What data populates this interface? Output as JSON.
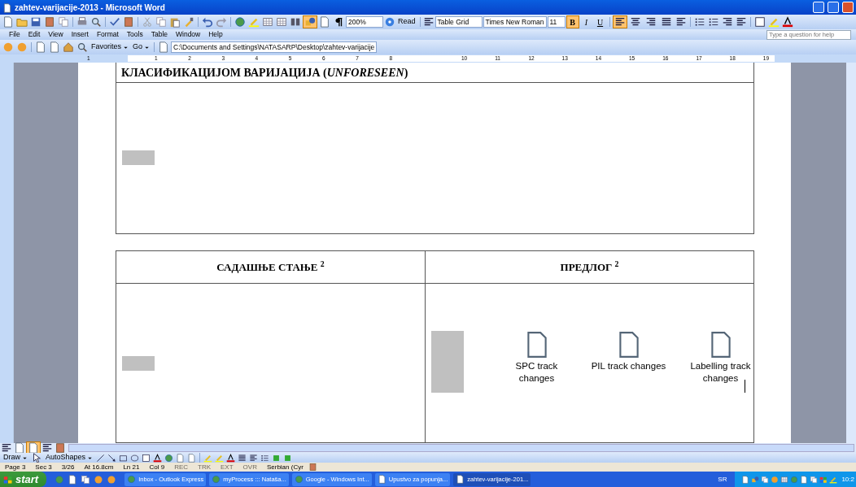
{
  "window": {
    "title": "zahtev-varijacije-2013 - Microsoft Word"
  },
  "standard_toolbar": {
    "zoom": "200%",
    "read": "Read",
    "style": "Table Grid",
    "font": "Times New Roman",
    "size": "11"
  },
  "format_buttons": [
    {
      "label": "B",
      "kind": "bold",
      "selected": true
    },
    {
      "label": "I",
      "kind": "italic",
      "selected": false
    },
    {
      "label": "U",
      "kind": "underline",
      "selected": false
    }
  ],
  "align_buttons": [
    {
      "kind": "left",
      "selected": true
    },
    {
      "kind": "center",
      "selected": false
    },
    {
      "kind": "right",
      "selected": false
    },
    {
      "kind": "justify",
      "selected": false
    }
  ],
  "menu": [
    "File",
    "Edit",
    "View",
    "Insert",
    "Format",
    "Tools",
    "Table",
    "Window",
    "Help"
  ],
  "help_box": {
    "placeholder": "Type a question for help"
  },
  "web_toolbar": {
    "favorites": "Favorites",
    "go": "Go",
    "address": "C:\\Documents and Settings\\NATASARP\\Desktop\\zahtev-varijacije"
  },
  "ruler": {
    "labels": [
      "1",
      "1",
      "2",
      "3",
      "4",
      "5",
      "6",
      "7",
      "8",
      "10",
      "11",
      "12",
      "13",
      "14",
      "15",
      "16",
      "17",
      "18",
      "19"
    ]
  },
  "document": {
    "heading": "КЛАСИФИКАЦИЈОМ ВАРИЈАЦИЈА (*UNFORESEEN*)",
    "table": {
      "columns": [
        "САДАШЊЕ СТАЊЕ $^{2}$",
        "ПРЕДЛОГ $^{2}$"
      ],
      "attachments": [
        {
          "label": "SPC track changes"
        },
        {
          "label": "PIL track changes"
        },
        {
          "label": "Labelling track changes"
        }
      ]
    }
  },
  "drawing_toolbar": {
    "draw": "Draw",
    "autoshapes": "AutoShapes"
  },
  "status_bar": {
    "items": [
      "Page 3",
      "Sec 3",
      "3/26",
      "At 16.8cm",
      "Ln 21",
      "Col 9"
    ],
    "modes": [
      {
        "label": "REC",
        "disabled": true
      },
      {
        "label": "TRK",
        "disabled": true
      },
      {
        "label": "EXT",
        "disabled": true
      },
      {
        "label": "OVR",
        "disabled": true
      }
    ],
    "language": "Serbian (Cyr"
  },
  "taskbar": {
    "start": "start",
    "tasks": [
      {
        "label": "Inbox - Outlook Express",
        "selected": false
      },
      {
        "label": "myProcess ::: Nataša...",
        "selected": false
      },
      {
        "label": "Google - Windows Int...",
        "selected": false
      },
      {
        "label": "Upustvo za popunja...",
        "selected": false
      },
      {
        "label": "zahtev-varijacije-201...",
        "selected": true
      }
    ],
    "language": "SR",
    "clock": "10:2"
  }
}
